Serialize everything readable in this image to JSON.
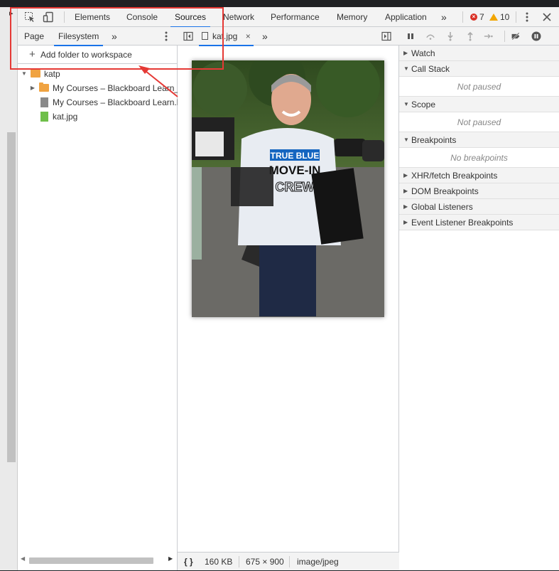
{
  "toolbar": {
    "tabs": [
      "Elements",
      "Console",
      "Sources",
      "Network",
      "Performance",
      "Memory",
      "Application"
    ],
    "active_tab": "Sources",
    "more": "»",
    "errors": "7",
    "warnings": "10"
  },
  "navigator": {
    "tabs": [
      "Page",
      "Filesystem"
    ],
    "active_tab": "Filesystem",
    "more": "»",
    "add_folder": "Add folder to workspace",
    "tree": [
      {
        "label": "katp",
        "type": "folder",
        "expanded": true
      },
      {
        "label": "My Courses – Blackboard Learn_files",
        "type": "folder",
        "expanded": false
      },
      {
        "label": "My Courses – Blackboard Learn.html",
        "type": "file"
      },
      {
        "label": "kat.jpg",
        "type": "image"
      }
    ]
  },
  "editor": {
    "tab_label": "kat.jpg",
    "more": "»",
    "status": {
      "format_icon": "{ }",
      "size": "160 KB",
      "dimensions": "675 × 900",
      "mime": "image/jpeg"
    }
  },
  "debugger": {
    "sections": [
      {
        "title": "Watch",
        "expanded": false
      },
      {
        "title": "Call Stack",
        "expanded": true,
        "empty": "Not paused"
      },
      {
        "title": "Scope",
        "expanded": true,
        "empty": "Not paused"
      },
      {
        "title": "Breakpoints",
        "expanded": true,
        "empty": "No breakpoints"
      },
      {
        "title": "XHR/fetch Breakpoints",
        "expanded": false
      },
      {
        "title": "DOM Breakpoints",
        "expanded": false
      },
      {
        "title": "Global Listeners",
        "expanded": false
      },
      {
        "title": "Event Listener Breakpoints",
        "expanded": false
      }
    ]
  },
  "image": {
    "shirt_line1": "TRUE BLUE",
    "shirt_line2": "MOVE-IN",
    "shirt_line3": "CREW"
  },
  "colors": {
    "accent": "#1a73e8",
    "annotation": "#e53935",
    "error": "#d93025",
    "warning": "#f2a600",
    "folder": "#f0a341"
  }
}
